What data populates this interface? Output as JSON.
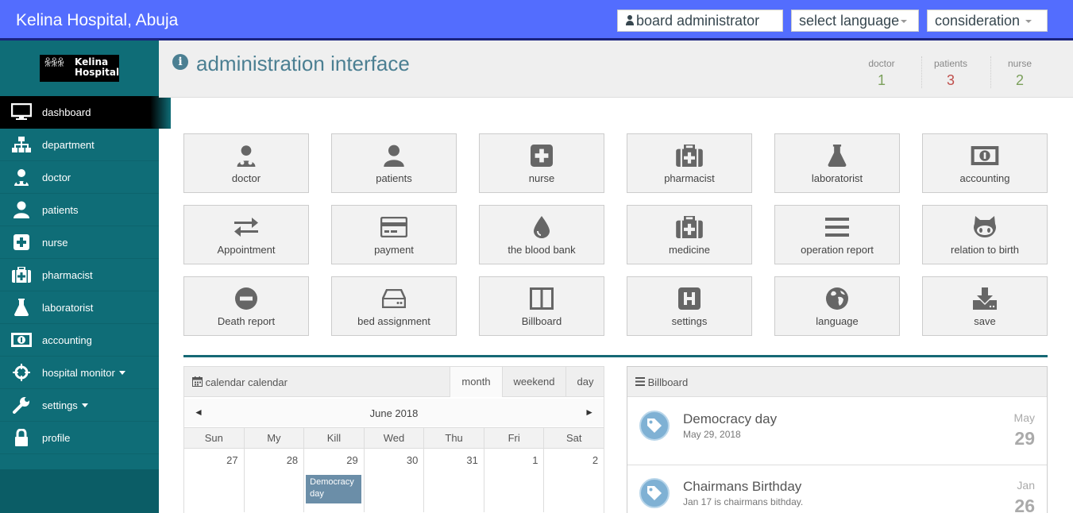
{
  "topbar": {
    "brand": "Kelina Hospital, Abuja",
    "user_label": "board administrator",
    "language_label": "select language",
    "account_label": "consideration"
  },
  "logo": {
    "line1": "Kelina",
    "line2": "Hospital"
  },
  "sidebar": {
    "items": [
      {
        "label": "dashboard",
        "icon": "monitor-icon"
      },
      {
        "label": "department",
        "icon": "sitemap-icon"
      },
      {
        "label": "doctor",
        "icon": "user-md-icon"
      },
      {
        "label": "patients",
        "icon": "user-icon"
      },
      {
        "label": "nurse",
        "icon": "plus-square-icon"
      },
      {
        "label": "pharmacist",
        "icon": "medkit-icon"
      },
      {
        "label": "laboratorist",
        "icon": "flask-icon"
      },
      {
        "label": "accounting",
        "icon": "money-icon"
      },
      {
        "label": "hospital monitor",
        "icon": "crosshair-icon"
      },
      {
        "label": "settings",
        "icon": "wrench-icon"
      },
      {
        "label": "profile",
        "icon": "lock-icon"
      }
    ]
  },
  "header": {
    "title": "administration interface",
    "stats": [
      {
        "label": "doctor",
        "value": "1",
        "color": "#7ba05b"
      },
      {
        "label": "patients",
        "value": "3",
        "color": "#c0504d"
      },
      {
        "label": "nurse",
        "value": "2",
        "color": "#7ba05b"
      }
    ]
  },
  "tiles": [
    {
      "label": "doctor",
      "icon": "user-md-icon"
    },
    {
      "label": "patients",
      "icon": "user-icon"
    },
    {
      "label": "nurse",
      "icon": "plus-square-icon"
    },
    {
      "label": "pharmacist",
      "icon": "medkit-icon"
    },
    {
      "label": "laboratorist",
      "icon": "flask-icon"
    },
    {
      "label": "accounting",
      "icon": "money-icon"
    },
    {
      "label": "Appointment",
      "icon": "exchange-icon"
    },
    {
      "label": "payment",
      "icon": "credit-card-icon"
    },
    {
      "label": "the blood bank",
      "icon": "tint-icon"
    },
    {
      "label": "medicine",
      "icon": "medkit-icon"
    },
    {
      "label": "operation report",
      "icon": "bars-icon"
    },
    {
      "label": "relation to birth",
      "icon": "github-icon"
    },
    {
      "label": "Death report",
      "icon": "minus-circle-icon"
    },
    {
      "label": "bed assignment",
      "icon": "hdd-icon"
    },
    {
      "label": "Billboard",
      "icon": "columns-icon"
    },
    {
      "label": "settings",
      "icon": "h-square-icon"
    },
    {
      "label": "language",
      "icon": "globe-icon"
    },
    {
      "label": "save",
      "icon": "download-icon"
    }
  ],
  "calendar": {
    "title": "calendar calendar",
    "tabs": [
      "month",
      "weekend",
      "day"
    ],
    "month_label": "June 2018",
    "prev": "◄",
    "next": "►",
    "weekdays": [
      "Sun",
      "My",
      "Kill",
      "Wed",
      "Thu",
      "Fri",
      "Sat"
    ],
    "days": [
      "27",
      "28",
      "29",
      "30",
      "31",
      "1",
      "2"
    ],
    "event": "Democracy day"
  },
  "billboard": {
    "title": "Billboard",
    "items": [
      {
        "title": "Democracy day",
        "subtitle": "May 29, 2018",
        "month": "May",
        "day": "29"
      },
      {
        "title": "Chairmans Birthday",
        "subtitle": "Jan 17 is chairmans bithday.",
        "month": "Jan",
        "day": "26"
      }
    ]
  }
}
